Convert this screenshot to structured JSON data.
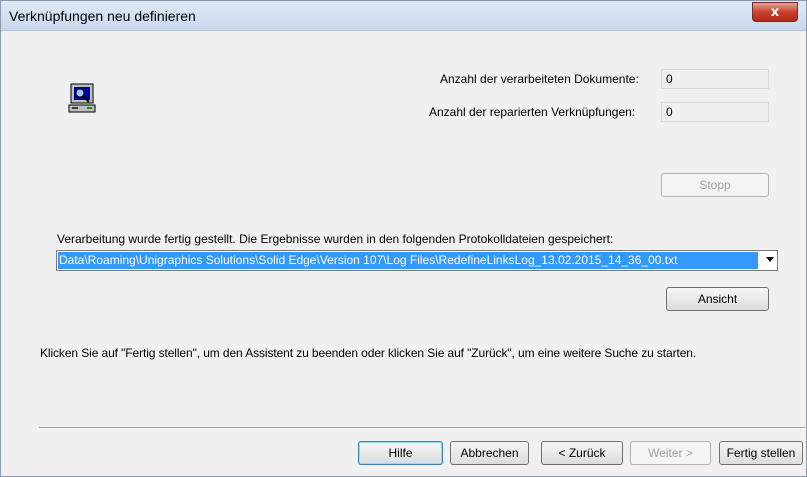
{
  "window": {
    "title": "Verknüpfungen neu definieren",
    "close_label": "x"
  },
  "stats": {
    "processed_label": "Anzahl der verarbeiteten Dokumente:",
    "processed_value": "0",
    "repaired_label": "Anzahl der reparierten Verknüpfungen:",
    "repaired_value": "0"
  },
  "stop_label": "Stopp",
  "result_text": "Verarbeitung wurde fertig gestellt. Die Ergebnisse wurden in den folgenden Protokolldateien gespeichert:",
  "logfile": "Data\\Roaming\\Unigraphics Solutions\\Solid Edge\\Version 107\\Log Files\\RedefineLinksLog_13.02.2015_14_36_00.txt",
  "view_label": "Ansicht",
  "instruction": "Klicken Sie auf \"Fertig stellen\", um den Assistent zu beenden oder klicken Sie auf \"Zurück\", um eine weitere Suche zu starten.",
  "buttons": {
    "help": "Hilfe",
    "cancel": "Abbrechen",
    "back": "< Zurück",
    "next": "Weiter >",
    "finish": "Fertig stellen"
  }
}
